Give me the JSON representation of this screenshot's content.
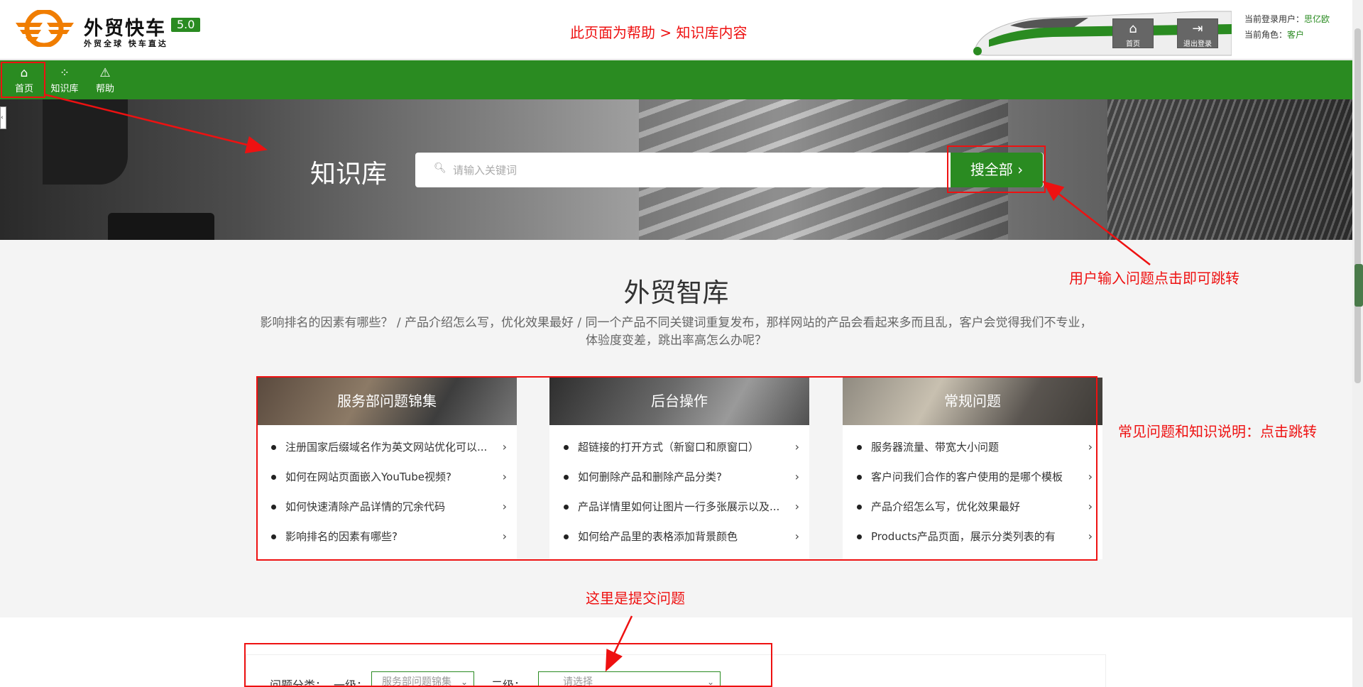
{
  "header": {
    "logo_title": "外贸快车",
    "logo_version": "5.0",
    "logo_slogan": "外贸全球 快车直达",
    "annotation": "此页面为帮助 > 知识库内容",
    "home_button": "首页",
    "logout_button": "退出登录",
    "user_label": "当前登录用户：",
    "user_value": "思亿欧",
    "role_label": "当前角色：",
    "role_value": "客户"
  },
  "nav": {
    "home": "首页",
    "kb": "知识库",
    "help": "帮助"
  },
  "hero": {
    "title": "知识库",
    "search_placeholder": "请输入关键词",
    "search_button": "搜全部 ›"
  },
  "section": {
    "title": "外贸智库",
    "description": "影响排名的因素有哪些？ / 产品介绍怎么写，优化效果最好 / 同一个产品不同关键词重复发布，那样网站的产品会看起来多而且乱，客户会觉得我们不专业，体验度变差，跳出率高怎么办呢？"
  },
  "cards": [
    {
      "title": "服务部问题锦集",
      "items": [
        "注册国家后缀域名作为英文网站优化可以...",
        "如何在网站页面嵌入YouTube视频?",
        "如何快速清除产品详情的冗余代码",
        "影响排名的因素有哪些?"
      ]
    },
    {
      "title": "后台操作",
      "items": [
        "超链接的打开方式（新窗口和原窗口）",
        "如何删除产品和删除产品分类?",
        "产品详情里如何让图片一行多张展示以及...",
        "如何给产品里的表格添加背景颜色"
      ]
    },
    {
      "title": "常规问题",
      "items": [
        "服务器流量、带宽大小问题",
        "客户问我们合作的客户使用的是哪个模板",
        "产品介绍怎么写，优化效果最好",
        "Products产品页面，展示分类列表的有"
      ]
    }
  ],
  "annotations": {
    "search": "用户输入问题点击即可跳转",
    "cards": "常见问题和知识说明：点击跳转",
    "submit": "这里是提交问题"
  },
  "form": {
    "category_label": "问题分类：",
    "level1_label": "一级：",
    "level1_value": "服务部问题锦集",
    "level2_label": "二级：",
    "level2_value": "请选择"
  },
  "colors": {
    "brand_green": "#2a8b21",
    "annotation_red": "#e11111",
    "logo_orange": "#f07d00"
  },
  "icons": {
    "home": "home-icon",
    "kb": "grid-circles-icon",
    "help": "warning-triangle-icon",
    "logout": "logout-icon",
    "search": "search-icon",
    "arrow": "chevron-right-icon"
  }
}
